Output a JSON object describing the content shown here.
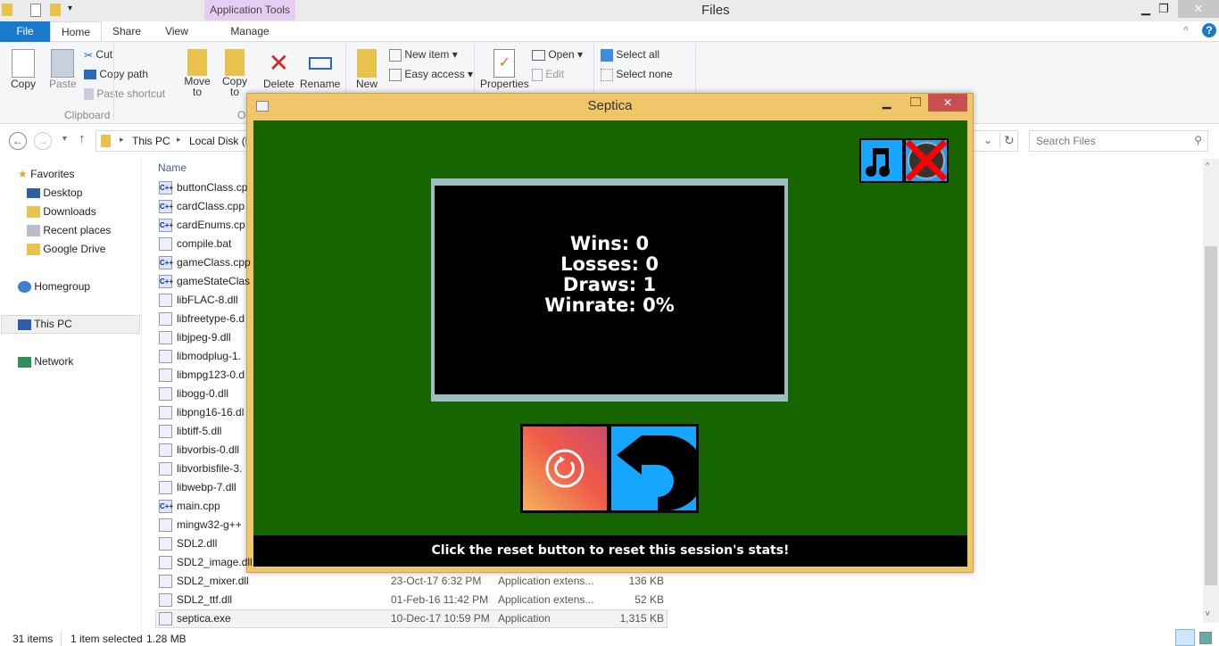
{
  "explorer": {
    "title": "Files",
    "context_tab": "Application Tools",
    "tabs": [
      "File",
      "Home",
      "Share",
      "View",
      "Manage"
    ],
    "ribbon": {
      "copy": "Copy",
      "paste": "Paste",
      "cut": "Cut",
      "copy_path": "Copy path",
      "paste_shortcut": "Paste shortcut",
      "clipboard_group": "Clipboard",
      "organize_group_partial": "O",
      "move_to": "Move to",
      "copy_to": "Copy to",
      "delete": "Delete",
      "rename": "Rename",
      "new": "New",
      "new_item": "New item",
      "easy_access": "Easy access",
      "properties": "Properties",
      "open": "Open",
      "edit": "Edit",
      "select_all": "Select all",
      "select_none": "Select none",
      "dropdown": "▾"
    },
    "address": {
      "crumbs": [
        "This PC",
        "Local Disk (D"
      ]
    },
    "search_placeholder": "Search Files",
    "nav": {
      "favorites": "Favorites",
      "items": [
        "Desktop",
        "Downloads",
        "Recent places",
        "Google Drive"
      ],
      "homegroup": "Homegroup",
      "this_pc": "This PC",
      "network": "Network"
    },
    "column_name": "Name",
    "files": [
      {
        "name": "buttonClass.cp",
        "type": "cpp"
      },
      {
        "name": "cardClass.cpp",
        "type": "cpp"
      },
      {
        "name": "cardEnums.cp",
        "type": "cpp"
      },
      {
        "name": "compile.bat",
        "type": "bat"
      },
      {
        "name": "gameClass.cpp",
        "type": "cpp"
      },
      {
        "name": "gameStateClas",
        "type": "cpp"
      },
      {
        "name": "libFLAC-8.dll",
        "type": "dll"
      },
      {
        "name": "libfreetype-6.d",
        "type": "dll"
      },
      {
        "name": "libjpeg-9.dll",
        "type": "dll"
      },
      {
        "name": "libmodplug-1.",
        "type": "dll"
      },
      {
        "name": "libmpg123-0.d",
        "type": "dll"
      },
      {
        "name": "libogg-0.dll",
        "type": "dll"
      },
      {
        "name": "libpng16-16.dl",
        "type": "dll"
      },
      {
        "name": "libtiff-5.dll",
        "type": "dll"
      },
      {
        "name": "libvorbis-0.dll",
        "type": "dll"
      },
      {
        "name": "libvorbisfile-3.",
        "type": "dll"
      },
      {
        "name": "libwebp-7.dll",
        "type": "dll"
      },
      {
        "name": "main.cpp",
        "type": "cpp"
      },
      {
        "name": "mingw32-g++",
        "type": "exe"
      },
      {
        "name": "SDL2.dll",
        "type": "dll"
      },
      {
        "name": "SDL2_image.dll",
        "type": "dll"
      },
      {
        "name": "SDL2_mixer.dll",
        "type": "dll",
        "date": "23-Oct-17 6:32 PM",
        "kind": "Application extens...",
        "size": "136 KB"
      },
      {
        "name": "SDL2_ttf.dll",
        "type": "dll",
        "date": "01-Feb-16 11:42 PM",
        "kind": "Application extens...",
        "size": "52 KB"
      },
      {
        "name": "septica.exe",
        "type": "exe",
        "date": "10-Dec-17 10:59 PM",
        "kind": "Application",
        "size": "1,315 KB",
        "selected": true
      }
    ],
    "status": {
      "count": "31 items",
      "selected": "1 item selected",
      "size": "1.28 MB"
    }
  },
  "septica": {
    "title": "Septica",
    "stats": [
      "Wins: 0",
      "Losses: 0",
      "Draws: 1",
      "Winrate: 0%"
    ],
    "hint": "Click the reset button to reset this session's stats!",
    "colors": {
      "green": "#166500",
      "titlebar": "#efc66a",
      "button_blue": "#17a6ff",
      "mute": "#ff0000"
    }
  }
}
